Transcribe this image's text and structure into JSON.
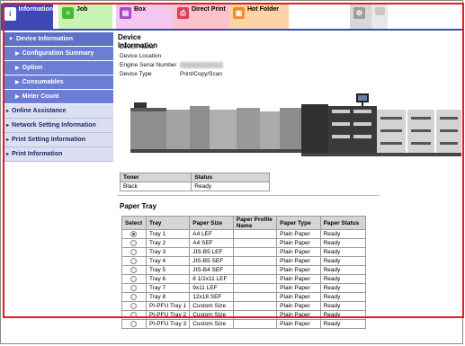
{
  "tabs": [
    {
      "label": "Information"
    },
    {
      "label": "Job"
    },
    {
      "label": "Box"
    },
    {
      "label": "Direct Print"
    },
    {
      "label": "Hot Folder"
    }
  ],
  "sidebar": {
    "items": [
      {
        "label": "Device Information"
      },
      {
        "label": "Configuration Summary"
      },
      {
        "label": "Option"
      },
      {
        "label": "Consumables"
      },
      {
        "label": "Meter Count"
      },
      {
        "label": "Online Assistance"
      },
      {
        "label": "Network Setting Information"
      },
      {
        "label": "Print Setting Information"
      },
      {
        "label": "Print Information"
      }
    ]
  },
  "device_info": {
    "title": "Device Information",
    "rows": [
      {
        "label": "Device Name",
        "value": ""
      },
      {
        "label": "Device Location",
        "value": ""
      },
      {
        "label": "Engine Serial Number",
        "value": ""
      },
      {
        "label": "Device Type",
        "value": "Print/Copy/Scan"
      }
    ]
  },
  "toner": {
    "headers": [
      "Toner",
      "Status"
    ],
    "rows": [
      [
        "Black",
        "Ready"
      ]
    ]
  },
  "paper_tray": {
    "title": "Paper Tray",
    "headers": [
      "Select",
      "Tray",
      "Paper Size",
      "Paper Profile Name",
      "Paper Type",
      "Paper Status"
    ],
    "rows": [
      {
        "selected": true,
        "tray": "Tray 1",
        "size": "A4 LEF",
        "profile": "",
        "type": "Plain Paper",
        "status": "Ready"
      },
      {
        "selected": false,
        "tray": "Tray 2",
        "size": "A4 SEF",
        "profile": "",
        "type": "Plain Paper",
        "status": "Ready"
      },
      {
        "selected": false,
        "tray": "Tray 3",
        "size": "JIS-B5 LEF",
        "profile": "",
        "type": "Plain Paper",
        "status": "Ready"
      },
      {
        "selected": false,
        "tray": "Tray 4",
        "size": "JIS-B5 SEF",
        "profile": "",
        "type": "Plain Paper",
        "status": "Ready"
      },
      {
        "selected": false,
        "tray": "Tray 5",
        "size": "JIS-B4 SEF",
        "profile": "",
        "type": "Plain Paper",
        "status": "Ready"
      },
      {
        "selected": false,
        "tray": "Tray 6",
        "size": "8 1/2x11 LEF",
        "profile": "",
        "type": "Plain Paper",
        "status": "Ready"
      },
      {
        "selected": false,
        "tray": "Tray 7",
        "size": "9x11 LEF",
        "profile": "",
        "type": "Plain Paper",
        "status": "Ready"
      },
      {
        "selected": false,
        "tray": "Tray 8",
        "size": "12x18 SEF",
        "profile": "",
        "type": "Plain Paper",
        "status": "Ready"
      },
      {
        "selected": false,
        "tray": "PI-PFU Tray 1",
        "size": "Custom Size",
        "profile": "",
        "type": "Plain Paper",
        "status": "Ready"
      },
      {
        "selected": false,
        "tray": "PI-PFU Tray 2",
        "size": "Custom Size",
        "profile": "",
        "type": "Plain Paper",
        "status": "Ready"
      },
      {
        "selected": false,
        "tray": "PI-PFU Tray 3",
        "size": "Custom Size",
        "profile": "",
        "type": "Plain Paper",
        "status": "Ready"
      }
    ]
  },
  "colors": {
    "accent": "#3d48b6",
    "sidebar": "#6b7dd4",
    "highlight_border": "#e31b23"
  }
}
